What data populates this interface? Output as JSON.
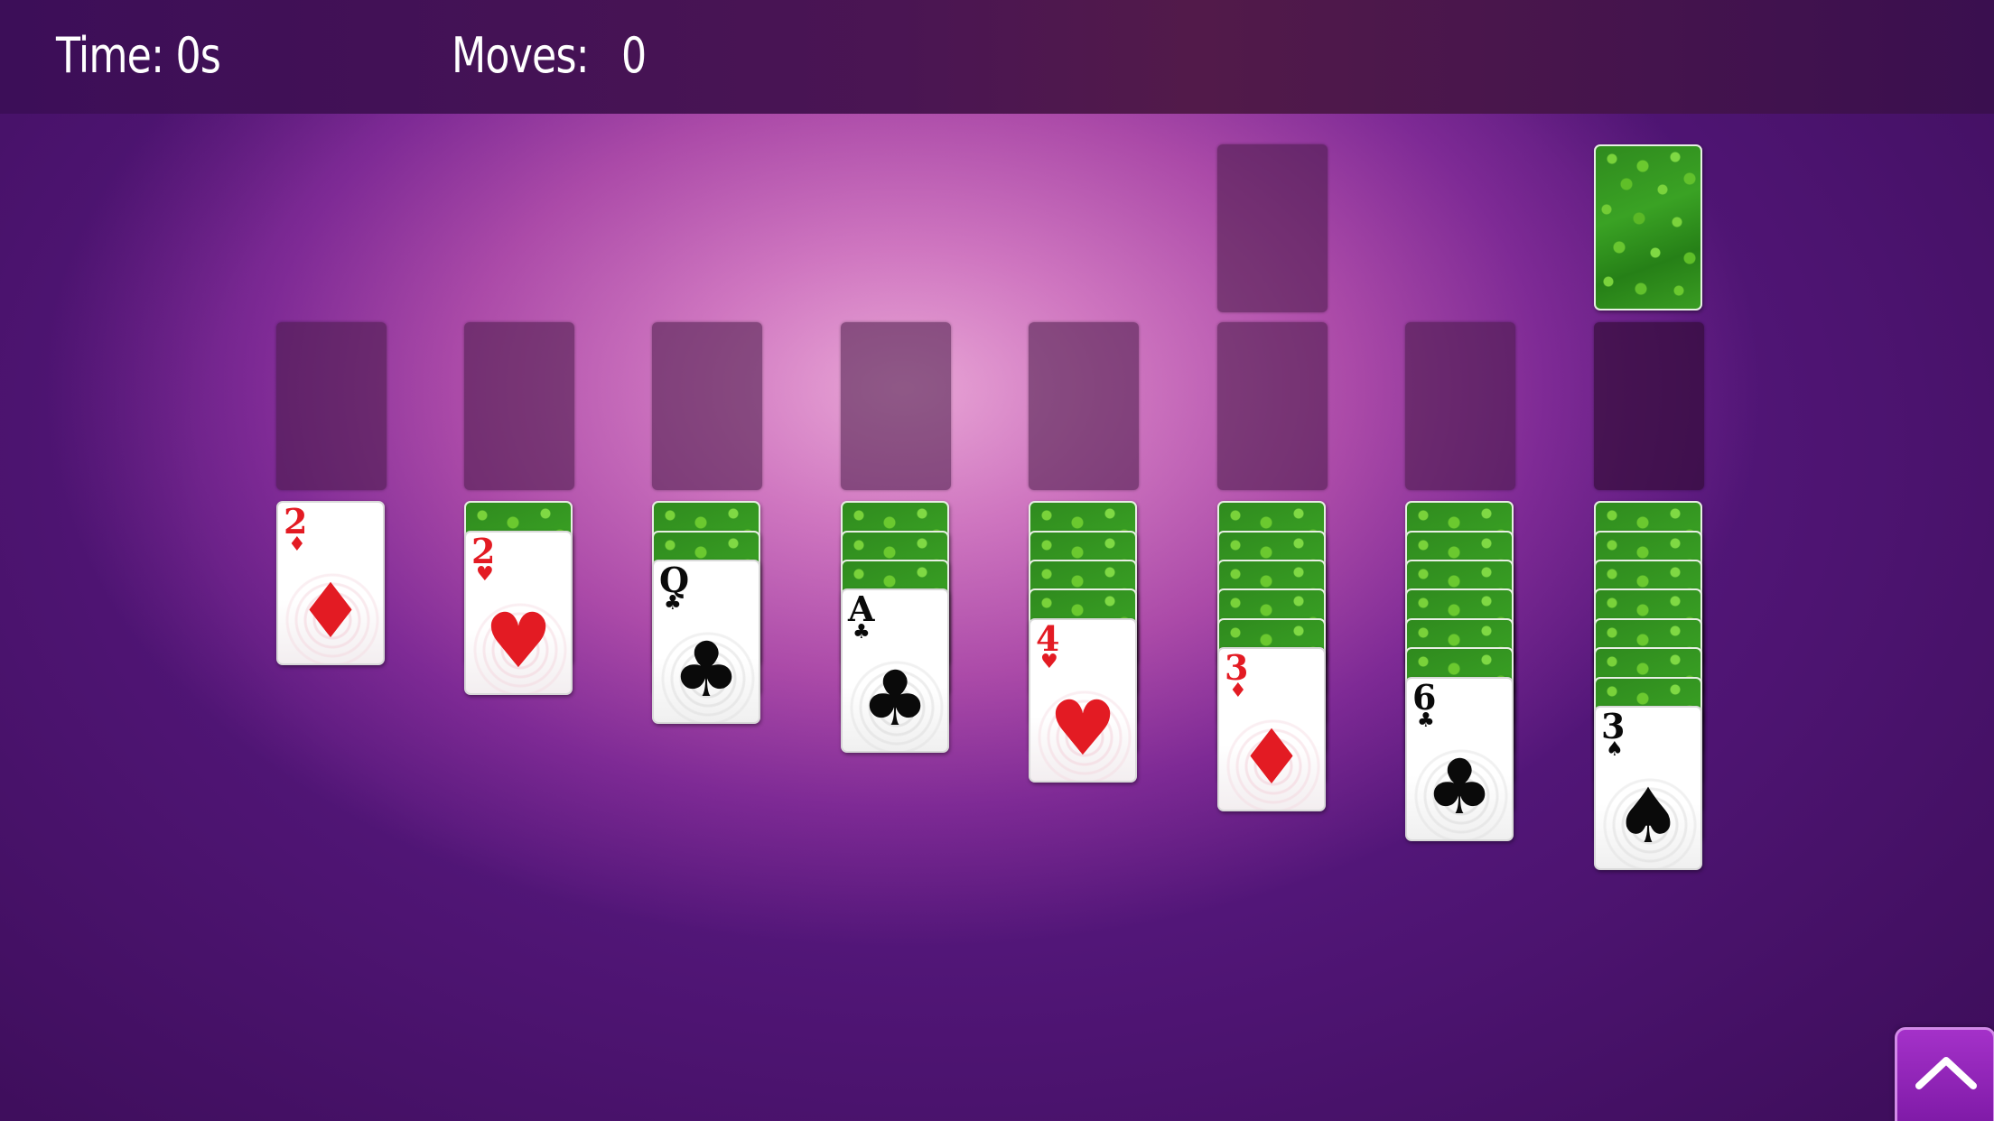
{
  "hud": {
    "time_label": "Time:",
    "time_value": "0s",
    "moves_label": "Moves:",
    "moves_value": "0"
  },
  "game": {
    "name": "Spider/Klondike-style Solitaire",
    "stock": {
      "face": "down",
      "back_design": "green-clover"
    },
    "foundations_visible": 1,
    "tableau": [
      {
        "column": 1,
        "face_down": 0,
        "top_card": {
          "rank": "2",
          "suit": "diamonds",
          "symbol": "♦",
          "color": "red"
        }
      },
      {
        "column": 2,
        "face_down": 1,
        "top_card": {
          "rank": "2",
          "suit": "hearts",
          "symbol": "♥",
          "color": "red"
        }
      },
      {
        "column": 3,
        "face_down": 2,
        "top_card": {
          "rank": "Q",
          "suit": "clubs",
          "symbol": "♣",
          "color": "black"
        }
      },
      {
        "column": 4,
        "face_down": 3,
        "top_card": {
          "rank": "A",
          "suit": "clubs",
          "symbol": "♣",
          "color": "black"
        }
      },
      {
        "column": 5,
        "face_down": 4,
        "top_card": {
          "rank": "4",
          "suit": "hearts",
          "symbol": "♥",
          "color": "red"
        }
      },
      {
        "column": 6,
        "face_down": 5,
        "top_card": {
          "rank": "3",
          "suit": "diamonds",
          "symbol": "♦",
          "color": "red"
        }
      },
      {
        "column": 7,
        "face_down": 6,
        "top_card": {
          "rank": "6",
          "suit": "clubs",
          "symbol": "♣",
          "color": "black"
        }
      },
      {
        "column": 8,
        "face_down": 7,
        "top_card": {
          "rank": "3",
          "suit": "spades",
          "symbol": "♠",
          "color": "black"
        }
      }
    ]
  },
  "controls": {
    "menu_button_icon": "chevron-up-icon"
  },
  "colors": {
    "red_suit": "#e31b23",
    "black_suit": "#0a0a0a",
    "button_accent": "#a431c9"
  }
}
